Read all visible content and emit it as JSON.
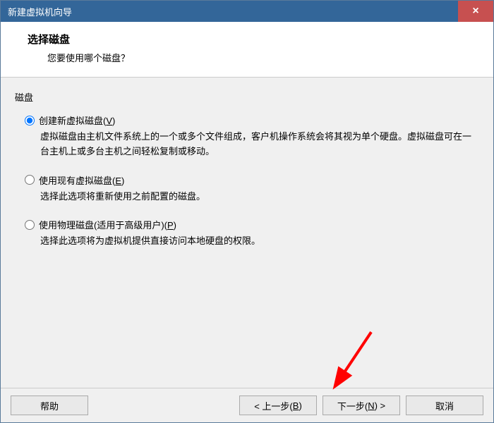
{
  "titlebar": {
    "title": "新建虚拟机向导",
    "close": "×"
  },
  "header": {
    "title": "选择磁盘",
    "subtitle": "您要使用哪个磁盘？"
  },
  "group_label": "磁盘",
  "options": [
    {
      "label_pre": "创建新虚拟磁盘(",
      "hotkey": "V",
      "label_post": ")",
      "desc": "虚拟磁盘由主机文件系统上的一个或多个文件组成，客户机操作系统会将其视为单个硬盘。虚拟磁盘可在一台主机上或多台主机之间轻松复制或移动。",
      "checked": true
    },
    {
      "label_pre": "使用现有虚拟磁盘(",
      "hotkey": "E",
      "label_post": ")",
      "desc": "选择此选项将重新使用之前配置的磁盘。",
      "checked": false
    },
    {
      "label_pre": "使用物理磁盘(适用于高级用户)(",
      "hotkey": "P",
      "label_post": ")",
      "desc": "选择此选项将为虚拟机提供直接访问本地硬盘的权限。",
      "checked": false
    }
  ],
  "buttons": {
    "help": "帮助",
    "back_pre": "< 上一步(",
    "back_key": "B",
    "back_post": ")",
    "next_pre": "下一步(",
    "next_key": "N",
    "next_post": ") >",
    "cancel": "取消"
  },
  "colors": {
    "titlebar_bg": "#336699",
    "close_bg": "#c75050",
    "content_bg": "#f0f0f0",
    "arrow": "#ff0000"
  }
}
